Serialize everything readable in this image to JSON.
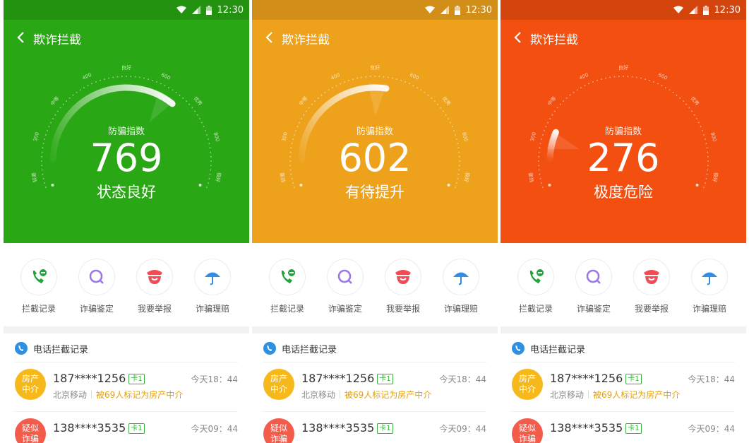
{
  "status": {
    "time": "12:30"
  },
  "title": "欺诈拦截",
  "gauge": {
    "label": "防骗指数",
    "scale": [
      "较差",
      "300",
      "中等",
      "400",
      "良好",
      "600",
      "优秀",
      "800",
      "极好"
    ]
  },
  "panels": [
    {
      "bg": "#2aa714",
      "score": "769",
      "fraction": 0.72,
      "status": "状态良好"
    },
    {
      "bg": "#eea21c",
      "score": "602",
      "fraction": 0.55,
      "status": "有待提升"
    },
    {
      "bg": "#f24f10",
      "score": "276",
      "fraction": 0.12,
      "status": "极度危险"
    }
  ],
  "actions": [
    {
      "label": "拦截记录",
      "icon": "phone-block-icon"
    },
    {
      "label": "诈骗鉴定",
      "icon": "search-icon"
    },
    {
      "label": "我要举报",
      "icon": "police-icon"
    },
    {
      "label": "诈骗理赔",
      "icon": "umbrella-icon"
    }
  ],
  "records": {
    "header": "电话拦截记录",
    "items": [
      {
        "avatar_line1": "房产",
        "avatar_line2": "中介",
        "number": "187****1256",
        "card": "卡1",
        "time": "今天18：44",
        "carrier": "北京移动",
        "tag": "被69人标记为房产中介",
        "avatar_color": "#f7b81c"
      },
      {
        "avatar_line1": "疑似",
        "avatar_line2": "诈骗",
        "number": "138****3535",
        "card": "卡1",
        "time": "今天09：44",
        "carrier": "",
        "tag": "",
        "avatar_color": "#f35c4a"
      }
    ]
  }
}
